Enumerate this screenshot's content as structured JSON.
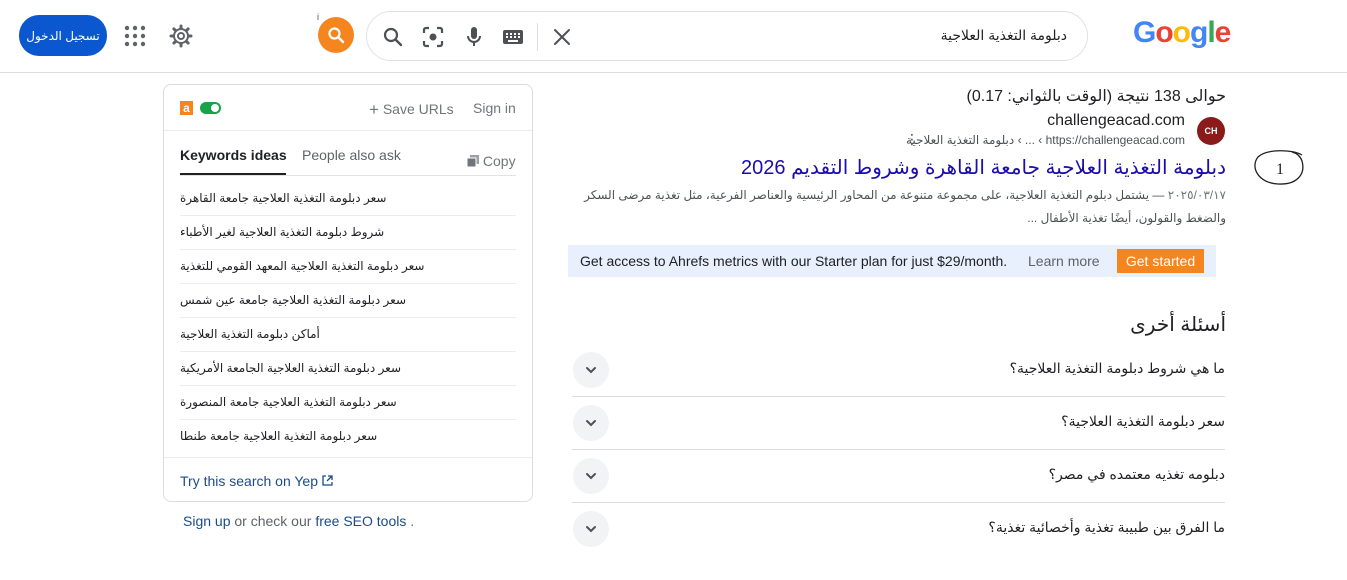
{
  "header": {
    "logo_letters": [
      "G",
      "o",
      "o",
      "g",
      "l",
      "e"
    ],
    "logo_colors": [
      "#4285F4",
      "#EA4335",
      "#FBBC05",
      "#4285F4",
      "#34A853",
      "#EA4335"
    ],
    "query": "دبلومة التغذية العلاجية",
    "signin_label": "تسجيل الدخول",
    "orange_info": "i",
    "icons": [
      "close-icon",
      "keyboard-icon",
      "mic-icon",
      "lens-icon",
      "search-icon",
      "ahrefs-search-icon",
      "gear-icon",
      "apps-icon"
    ]
  },
  "results": {
    "stats": "حوالى 138 نتيجة (الوقت بالثواني: 0.17)",
    "site_name": "challengeacad.com",
    "favicon_text": "CH",
    "site_url": "https://challengeacad.com › ... › دبلومة التغذية العلاجية",
    "title": "دبلومة التغذية العلاجية جامعة القاهرة وشروط التقديم 2026",
    "date": "٢٠٢٥/٠٣/١٧",
    "snippet": " — يشتمل دبلوم التغذية العلاجية، على مجموعة متنوعة من المحاور الرئيسية والعناصر الفرعية، مثل تغذية مرضى السكر والضغط والقولون، أيضًا تغذية الأطفال ...",
    "annotation_number": "1"
  },
  "banner": {
    "text": "Get access to Ahrefs metrics with our Starter plan for just $29/month.",
    "learn_more": "Learn more",
    "cta": "Get started",
    "bg": "#e8f0fe",
    "cta_color": "#f5861f"
  },
  "paa": {
    "title": "أسئلة أخرى",
    "questions": [
      "ما هي شروط دبلومة التغذية العلاجية؟",
      "سعر دبلومة التغذية العلاجية؟",
      "دبلومه تغذيه معتمده في مصر؟",
      "ما الفرق بين طبيبة تغذية وأخصائية تغذية؟"
    ]
  },
  "panel": {
    "logo": "a",
    "save_urls": "Save URLs",
    "sign_in": "Sign in",
    "tab_keywords": "Keywords ideas",
    "tab_paa": "People also ask",
    "copy": "Copy",
    "keywords": [
      "سعر دبلومة التغذية العلاجية جامعة القاهرة",
      "شروط دبلومة التغذية العلاجية لغير الأطباء",
      "سعر دبلومة التغذية العلاجية المعهد القومي للتغذية",
      "سعر دبلومة التغذية العلاجية جامعة عين شمس",
      "أماكن دبلومة التغذية العلاجية",
      "سعر دبلومة التغذية العلاجية الجامعة الأمريكية",
      "سعر دبلومة التغذية العلاجية جامعة المنصورة",
      "سعر دبلومة التغذية العلاجية جامعة طنطا"
    ],
    "try_yep": "Try this search on Yep",
    "footer_signup": "Sign up",
    "footer_mid": " or check our ",
    "footer_tools": "free SEO tools",
    "footer_end": " ."
  }
}
